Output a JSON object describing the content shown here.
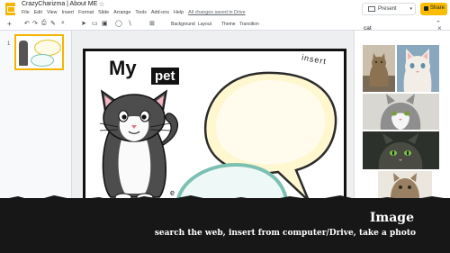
{
  "header": {
    "doc_title": "CrazyCharizma | About ME",
    "menus": [
      "File",
      "Edit",
      "View",
      "Insert",
      "Format",
      "Slide",
      "Arrange",
      "Tools",
      "Add-ons",
      "Help"
    ],
    "saved_status": "All changes saved in Drive",
    "present_label": "Present",
    "share_label": "Share"
  },
  "toolbar": {
    "background_label": "Background",
    "layout_label": "Layout",
    "theme_label": "Theme",
    "transition_label": "Transition"
  },
  "filmstrip": {
    "slide_number": "1"
  },
  "slide": {
    "title_word": "My",
    "title_highlight": "pet",
    "insert_text": "insert",
    "stray_letter": "e"
  },
  "image_search": {
    "query": "cat",
    "close_glyph": "×"
  },
  "caption": {
    "heading": "Image",
    "subtitle": "search the web, insert from computer/Drive, take a photo"
  },
  "colors": {
    "accent": "#fbbc04",
    "logo": "#f4b400",
    "banner": "#171717",
    "bubble_yellow_edge": "#e6c230",
    "bubble_teal_edge": "#7cc0b4"
  }
}
